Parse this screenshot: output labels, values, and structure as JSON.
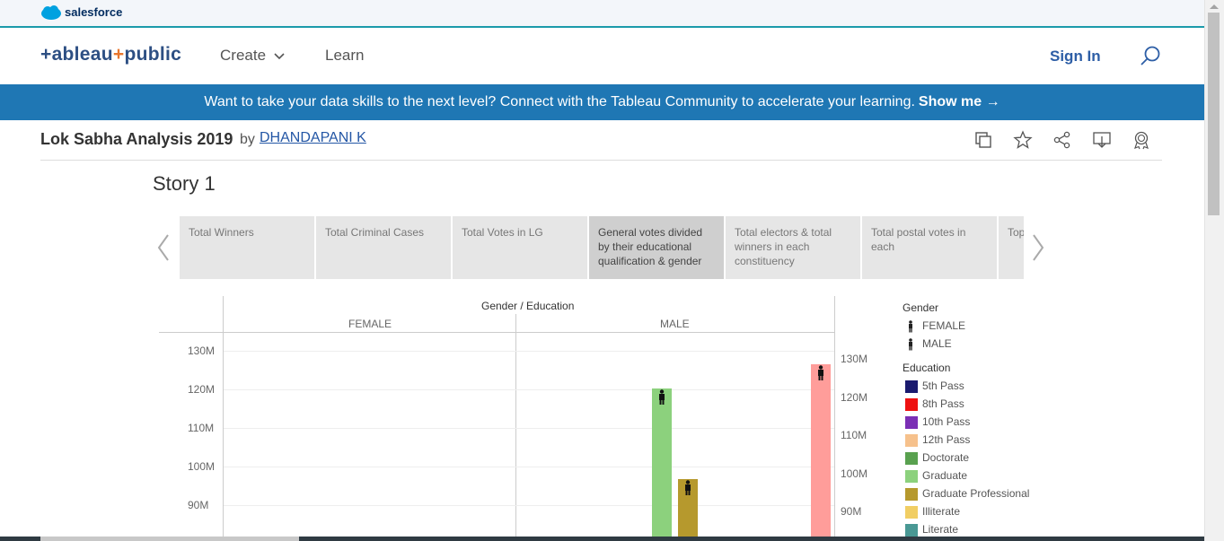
{
  "salesforce": {
    "brand": "salesforce"
  },
  "nav": {
    "logo": "+ableau",
    "logo_plus": "+",
    "logo_rest": "public",
    "create": "Create",
    "learn": "Learn",
    "sign_in": "Sign In"
  },
  "banner": {
    "text": "Want to take your data skills to the next level? Connect with the Tableau Community to accelerate your learning.",
    "cta": "Show me →"
  },
  "viz": {
    "title": "Lok Sabha Analysis 2019",
    "by": "by",
    "author": "DHANDAPANI K"
  },
  "story": {
    "title": "Story 1",
    "points": [
      {
        "label": "Total Winners",
        "active": false
      },
      {
        "label": "Total Criminal Cases",
        "active": false
      },
      {
        "label": "Total Votes in LG",
        "active": false
      },
      {
        "label": "General votes divided by their educational qualification & gender",
        "active": true
      },
      {
        "label": "Total electors & total winners in each constituency",
        "active": false
      },
      {
        "label": "Total postal votes in each",
        "active": false
      },
      {
        "label": "Top",
        "active": false
      }
    ]
  },
  "chart": {
    "header": "Gender / Education",
    "panes": [
      "FEMALE",
      "MALE"
    ],
    "left_ticks": [
      "130M",
      "120M",
      "110M",
      "100M",
      "90M"
    ],
    "right_ticks": [
      "130M",
      "120M",
      "110M",
      "100M",
      "90M"
    ],
    "legend": {
      "gender_title": "Gender",
      "genders": [
        "FEMALE",
        "MALE"
      ],
      "education_title": "Education",
      "items": [
        {
          "label": "5th Pass",
          "color": "#1a1a6e"
        },
        {
          "label": "8th Pass",
          "color": "#ee1111"
        },
        {
          "label": "10th Pass",
          "color": "#7b2fb5"
        },
        {
          "label": "12th Pass",
          "color": "#f6c18c"
        },
        {
          "label": "Doctorate",
          "color": "#59a14f"
        },
        {
          "label": "Graduate",
          "color": "#8cd17d"
        },
        {
          "label": "Graduate Professional",
          "color": "#b6992d"
        },
        {
          "label": "Illiterate",
          "color": "#f1ce63"
        },
        {
          "label": "Literate",
          "color": "#499894"
        }
      ]
    }
  },
  "chart_data": {
    "type": "bar",
    "xlabel": "Gender / Education",
    "ylim": [
      85000000,
      133000000
    ],
    "series": [
      {
        "name": "Graduate",
        "gender": "MALE",
        "value": 120200000,
        "color": "#8cd17d"
      },
      {
        "name": "Graduate Professional",
        "gender": "MALE",
        "value": 96800000,
        "color": "#b6992d"
      },
      {
        "name": "MALE",
        "gender": "MALE",
        "value": 128700000,
        "color": "#ff9d9a"
      }
    ]
  }
}
